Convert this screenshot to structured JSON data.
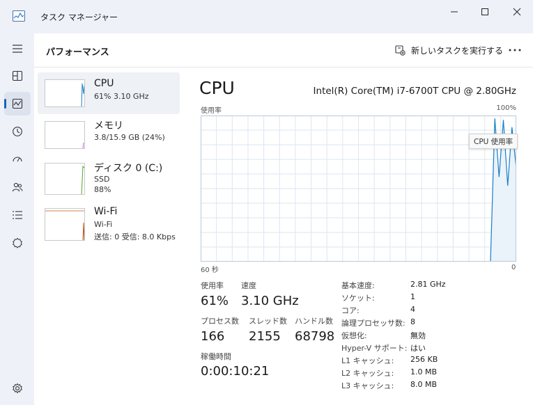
{
  "window": {
    "title": "タスク マネージャー",
    "icon": "task-manager-icon"
  },
  "header": {
    "title": "パフォーマンス",
    "new_task_label": "新しいタスクを実行する",
    "more_icon": "more-horizontal-icon"
  },
  "nav": {
    "items": [
      {
        "icon": "hamburger-icon"
      },
      {
        "icon": "processes-icon"
      },
      {
        "icon": "performance-icon",
        "active": true
      },
      {
        "icon": "app-history-icon"
      },
      {
        "icon": "startup-icon"
      },
      {
        "icon": "users-icon"
      },
      {
        "icon": "details-icon"
      },
      {
        "icon": "services-icon"
      },
      {
        "icon": "settings-icon"
      }
    ]
  },
  "resources": [
    {
      "name": "CPU",
      "sub1": "61%  3.10 GHz",
      "color": "#1a7fc4"
    },
    {
      "name": "メモリ",
      "sub1": "3.8/15.9 GB (24%)",
      "color": "#9b30c8"
    },
    {
      "name": "ディスク 0 (C:)",
      "sub1": "SSD",
      "sub2": "88%",
      "color": "#4fa428"
    },
    {
      "name": "Wi-Fi",
      "sub1": "Wi-Fi",
      "sub2": "送信: 0 受信: 8.0 Kbps",
      "color": "#c0581a"
    }
  ],
  "detail": {
    "title": "CPU",
    "model": "Intel(R) Core(TM) i7-6700T CPU @ 2.80GHz",
    "graph_label_top_left": "使用率",
    "graph_label_top_right": "100%",
    "graph_label_bottom_left": "60 秒",
    "graph_label_bottom_right": "0",
    "tooltip": "CPU 使用率",
    "graph_color": "#1a7fc4",
    "graph_fill": "#eaf2fa",
    "utilization_series": [
      0,
      98,
      58,
      97,
      52,
      92,
      64
    ]
  },
  "stats": {
    "usage_label": "使用率",
    "usage_value": "61%",
    "speed_label": "速度",
    "speed_value": "3.10 GHz",
    "processes_label": "プロセス数",
    "processes_value": "166",
    "threads_label": "スレッド数",
    "threads_value": "2155",
    "handles_label": "ハンドル数",
    "handles_value": "68798",
    "uptime_label": "稼働時間",
    "uptime_value": "0:00:10:21"
  },
  "specs": [
    {
      "label": "基本速度:",
      "value": "2.81 GHz"
    },
    {
      "label": "ソケット:",
      "value": "1"
    },
    {
      "label": "コア:",
      "value": "4"
    },
    {
      "label": "論理プロセッサ数:",
      "value": "8"
    },
    {
      "label": "仮想化:",
      "value": "無効"
    },
    {
      "label": "Hyper-V サポート:",
      "value": "はい"
    },
    {
      "label": "L1 キャッシュ:",
      "value": "256 KB"
    },
    {
      "label": "L2 キャッシュ:",
      "value": "1.0 MB"
    },
    {
      "label": "L3 キャッシュ:",
      "value": "8.0 MB"
    }
  ]
}
